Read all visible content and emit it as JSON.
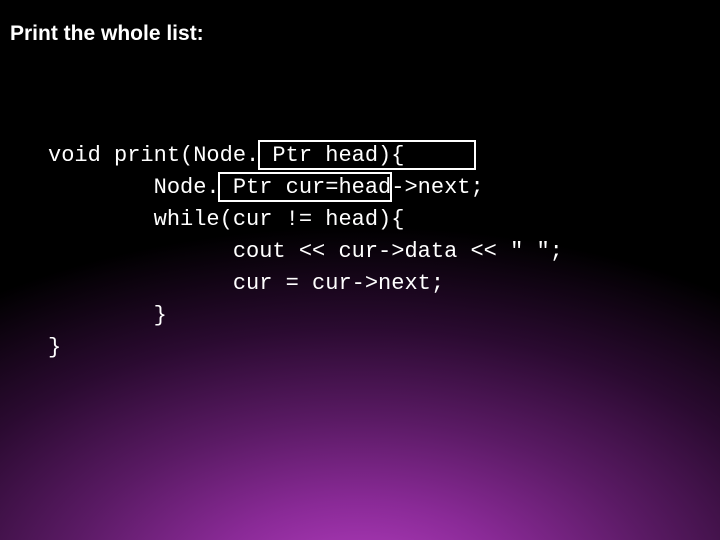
{
  "title": "Print the whole list:",
  "code": {
    "l1": "void print(Node. Ptr head){",
    "l2": "        Node. Ptr cur=head->next;",
    "l3": "        while(cur != head){",
    "l4": "              cout << cur->data << \" \";",
    "l5": "              cur = cur->next;",
    "l6": "        }",
    "l7": "}"
  }
}
